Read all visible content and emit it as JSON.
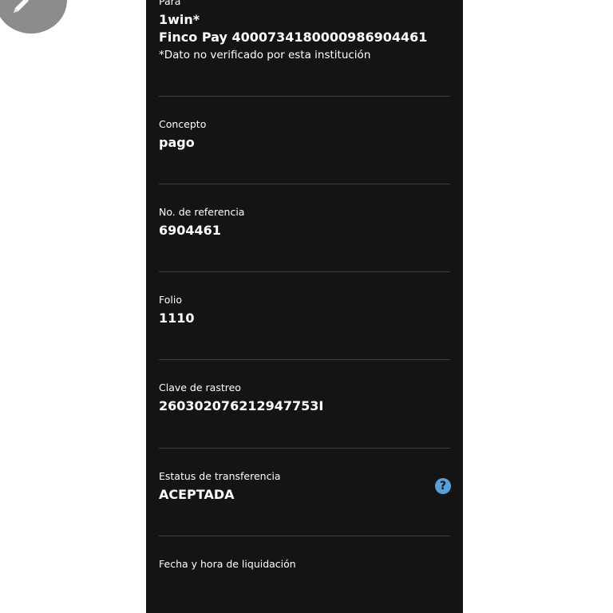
{
  "destination": {
    "label": "Para",
    "name": "1win*",
    "account": "Finco Pay 4000734180000986904461",
    "note": "*Dato no verificado por esta institución"
  },
  "concept": {
    "label": "Concepto",
    "value": "pago"
  },
  "reference": {
    "label": "No. de referencia",
    "value": "6904461"
  },
  "folio": {
    "label": "Folio",
    "value": "1110"
  },
  "tracking_key": {
    "label": "Clave de rastreo",
    "value": "260302076212947753I"
  },
  "transfer_status": {
    "label": "Estatus de transferencia",
    "value": "ACEPTADA",
    "help_icon": "question-circle-icon",
    "help_icon_color": "#5a9fd6"
  },
  "settlement": {
    "label": "Fecha y hora de liquidación"
  },
  "colors": {
    "panel_background": "#141414",
    "divider": "#3e3e3e",
    "text": "#ffffff",
    "edit_button": "#8c8c8c"
  },
  "edit_button_icon": "pencil-icon",
  "help_glyph": "?"
}
